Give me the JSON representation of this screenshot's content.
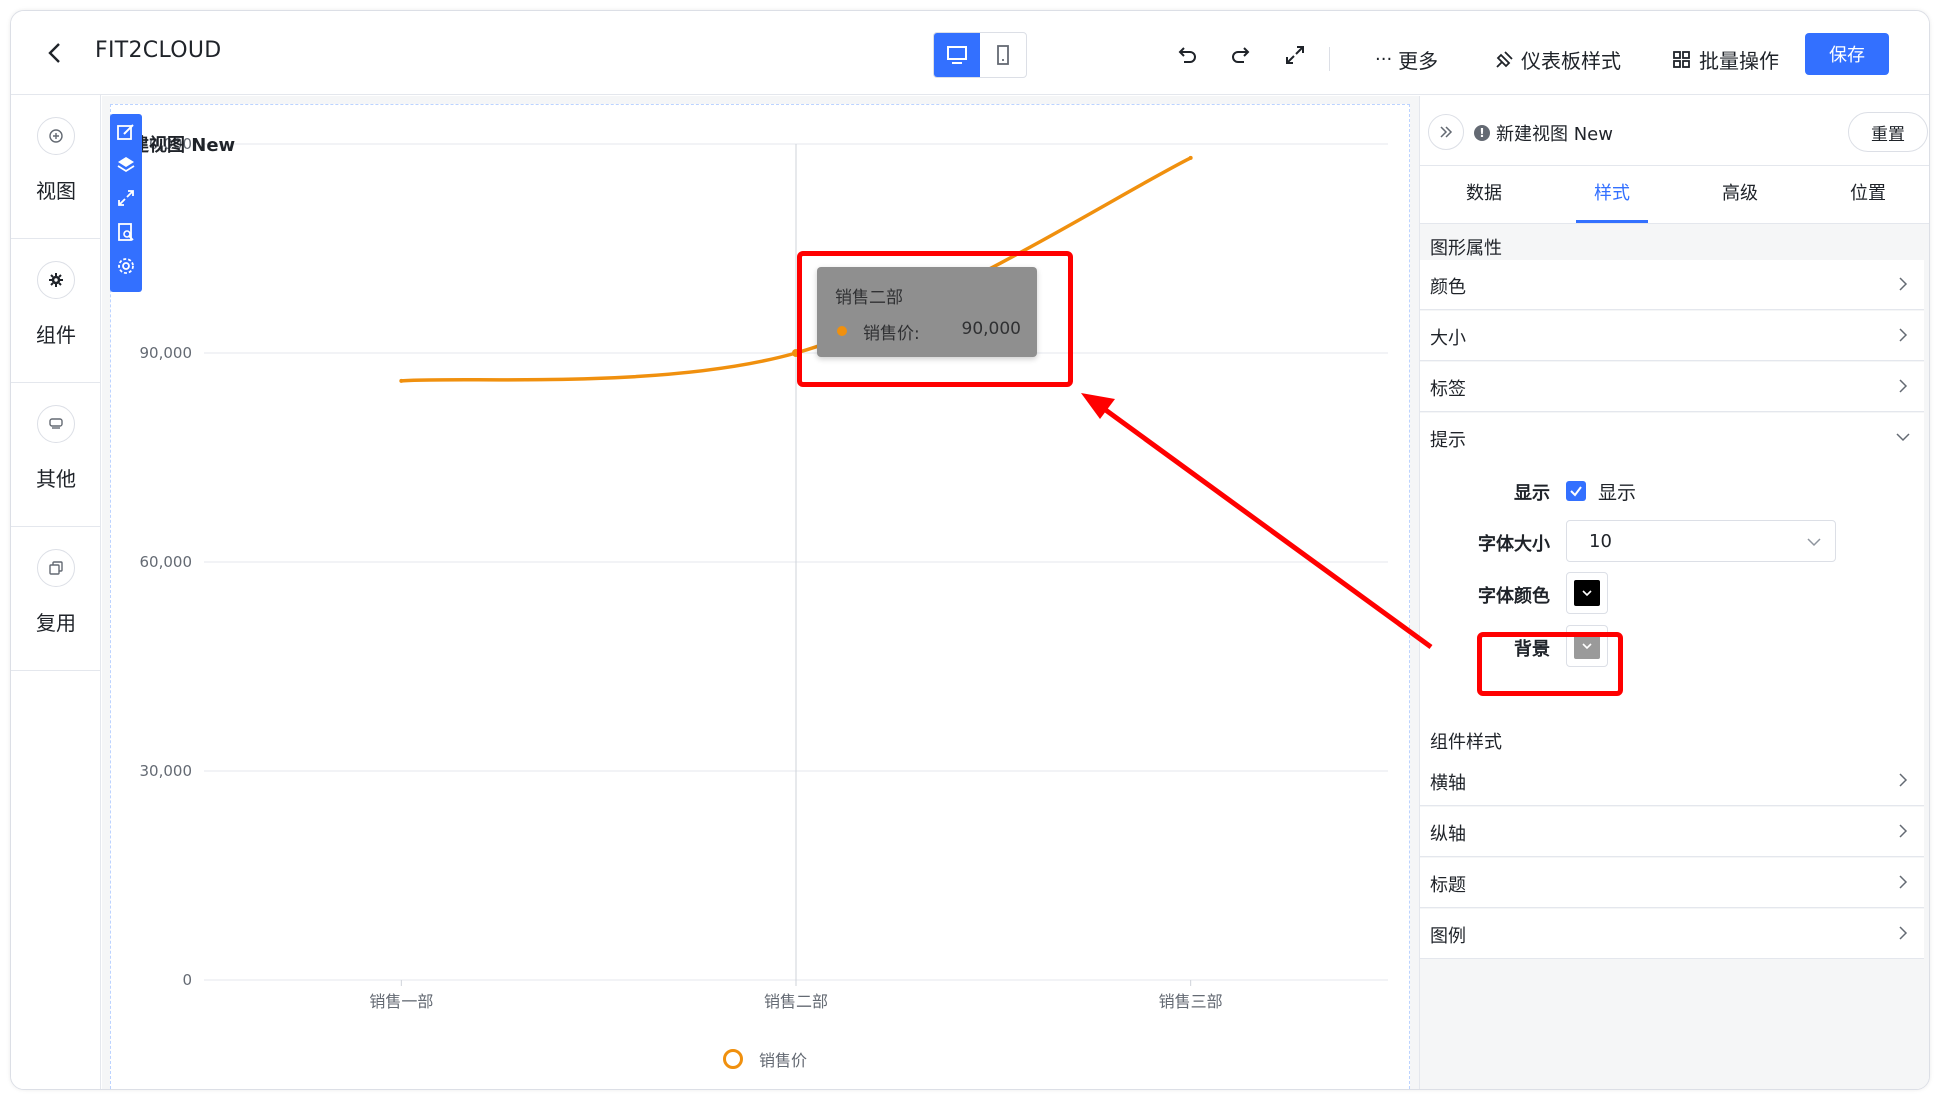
{
  "topbar": {
    "title": "FIT2CLOUD",
    "more": "更多",
    "dashboard_style": "仪表板样式",
    "batch_ops": "批量操作",
    "save": "保存"
  },
  "leftbar": {
    "items": [
      {
        "label": "视图"
      },
      {
        "label": "组件"
      },
      {
        "label": "其他"
      },
      {
        "label": "复用"
      }
    ]
  },
  "view": {
    "title": "建视图 New"
  },
  "tooltip": {
    "title": "销售二部",
    "series": "销售价:",
    "value": "90,000"
  },
  "panel": {
    "title": "新建视图 New",
    "reset": "重置",
    "tabs": [
      "数据",
      "样式",
      "高级",
      "位置"
    ],
    "active_tab": "样式",
    "graph_section": "图形属性",
    "graph_rows": [
      "颜色",
      "大小",
      "标签",
      "提示"
    ],
    "tip": {
      "show_label": "显示",
      "show_checkbox": "显示",
      "font_size_label": "字体大小",
      "font_size_value": "10",
      "font_color_label": "字体颜色",
      "font_color": "#000000",
      "bg_label": "背景",
      "bg_color": "#9a9a9a"
    },
    "component_section": "组件样式",
    "component_rows": [
      "横轴",
      "纵轴",
      "标题",
      "图例"
    ]
  },
  "colors": {
    "accent": "#3370ff",
    "series": "#f0900e",
    "annotation": "#ff0000"
  },
  "chart_data": {
    "type": "line",
    "categories": [
      "销售一部",
      "销售二部",
      "销售三部"
    ],
    "series": [
      {
        "name": "销售价",
        "values": [
          86000,
          90000,
          118000
        ]
      }
    ],
    "y_ticks": [
      "0",
      "30,000",
      "60,000",
      "90,000",
      "0,000"
    ],
    "ylim": [
      0,
      120000
    ],
    "legend_position": "bottom",
    "grid": true
  }
}
